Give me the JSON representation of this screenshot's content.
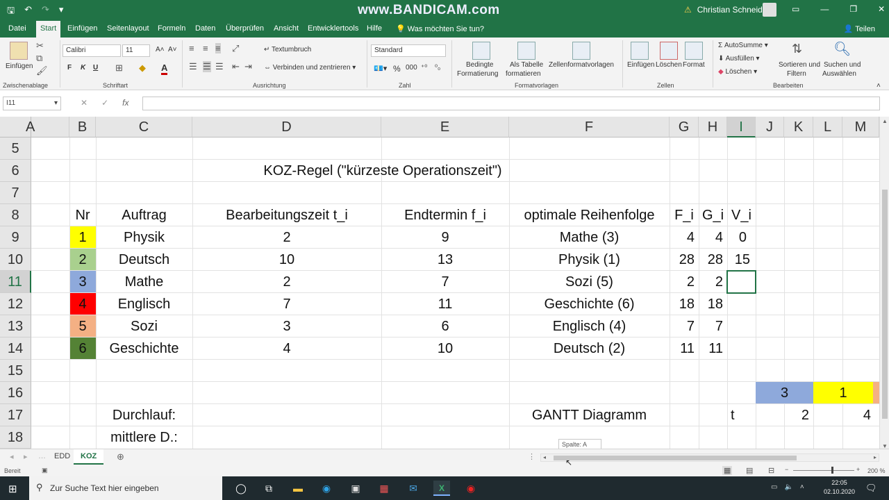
{
  "titlebar": {
    "watermark": "www.BANDICAM.com",
    "user_name": "Christian Schneider",
    "warning_icon": "warning-icon",
    "minimize": "—",
    "restore": "❐",
    "close": "✕"
  },
  "ribbon_tabs": [
    "Datei",
    "Start",
    "Einfügen",
    "Seitenlayout",
    "Formeln",
    "Daten",
    "Überprüfen",
    "Ansicht",
    "Entwicklertools",
    "Hilfe"
  ],
  "tell_me": "Was möchten Sie tun?",
  "share": "Teilen",
  "ribbon": {
    "clipboard": {
      "paste": "Einfügen",
      "label": "Zwischenablage"
    },
    "font": {
      "name": "Calibri",
      "size": "11",
      "bold": "F",
      "italic": "K",
      "underline": "U",
      "label": "Schriftart"
    },
    "alignment": {
      "wrap": "Textumbruch",
      "merge": "Verbinden und zentrieren",
      "label": "Ausrichtung"
    },
    "number": {
      "format": "Standard",
      "label": "Zahl"
    },
    "styles": {
      "conditional": "Bedingte",
      "conditional2": "Formatierung",
      "as_table": "Als Tabelle",
      "as_table2": "formatieren",
      "cell_styles": "Zellenformatvorlagen",
      "label": "Formatvorlagen"
    },
    "cells": {
      "insert": "Einfügen",
      "delete": "Löschen",
      "format": "Format",
      "label": "Zellen"
    },
    "editing": {
      "autosum": "AutoSumme",
      "fill": "Ausfüllen",
      "clear": "Löschen",
      "sort": "Sortieren und",
      "sort2": "Filtern",
      "find": "Suchen und",
      "find2": "Auswählen",
      "label": "Bearbeiten"
    }
  },
  "formula_bar": {
    "name_box": "I11",
    "fx": "fx",
    "content": ""
  },
  "columns": [
    "A",
    "B",
    "C",
    "D",
    "E",
    "F",
    "G",
    "H",
    "I",
    "J",
    "K",
    "L",
    "M"
  ],
  "rows": [
    "5",
    "6",
    "7",
    "8",
    "9",
    "10",
    "11",
    "12",
    "13",
    "14",
    "15",
    "16",
    "17",
    "18"
  ],
  "sheet": {
    "title": "KOZ-Regel  (\"kürzeste Operationszeit\")",
    "headers": {
      "nr": "Nr",
      "auftrag": "Auftrag",
      "bearbeitung": "Bearbeitungszeit t_i",
      "endtermin": "Endtermin f_i",
      "reihenfolge": "optimale Reihenfolge",
      "fi": "F_i",
      "gi": "G_i",
      "vi": "V_i"
    },
    "rows": [
      {
        "nr": "1",
        "auftrag": "Physik",
        "t": "2",
        "f": "9",
        "reihenfolge": "Mathe (3)",
        "F": "4",
        "G": "4",
        "V": "0",
        "color": "#ffff00"
      },
      {
        "nr": "2",
        "auftrag": "Deutsch",
        "t": "10",
        "f": "13",
        "reihenfolge": "Physik (1)",
        "F": "28",
        "G": "28",
        "V": "15",
        "color": "#a9d08e"
      },
      {
        "nr": "3",
        "auftrag": "Mathe",
        "t": "2",
        "f": "7",
        "reihenfolge": "Sozi (5)",
        "F": "2",
        "G": "2",
        "V": "",
        "color": "#8ea9db"
      },
      {
        "nr": "4",
        "auftrag": "Englisch",
        "t": "7",
        "f": "11",
        "reihenfolge": "Geschichte (6)",
        "F": "18",
        "G": "18",
        "V": "",
        "color": "#ff0000"
      },
      {
        "nr": "5",
        "auftrag": "Sozi",
        "t": "3",
        "f": "6",
        "reihenfolge": "Englisch (4)",
        "F": "7",
        "G": "7",
        "V": "",
        "color": "#f4b084"
      },
      {
        "nr": "6",
        "auftrag": "Geschichte",
        "t": "4",
        "f": "10",
        "reihenfolge": "Deutsch (2)",
        "F": "11",
        "G": "11",
        "V": "",
        "color": "#548235"
      }
    ],
    "durchlauf": "Durchlauf:",
    "mittlere": "mittlere D.:",
    "gantt_label": "GANTT Diagramm",
    "gantt_t": "t",
    "gantt_blocks": [
      {
        "label": "3",
        "color": "#8ea9db"
      },
      {
        "label": "1",
        "color": "#ffff00"
      }
    ],
    "gantt_ticks": [
      "2",
      "4"
    ]
  },
  "sheet_tabs": [
    "EDD",
    "KOZ"
  ],
  "tooltip": "Spalte: A",
  "status": {
    "ready": "Bereit",
    "zoom": "200 %"
  },
  "taskbar": {
    "search_placeholder": "Zur Suche Text hier eingeben",
    "time": "22:05",
    "date": "02.10.2020"
  }
}
